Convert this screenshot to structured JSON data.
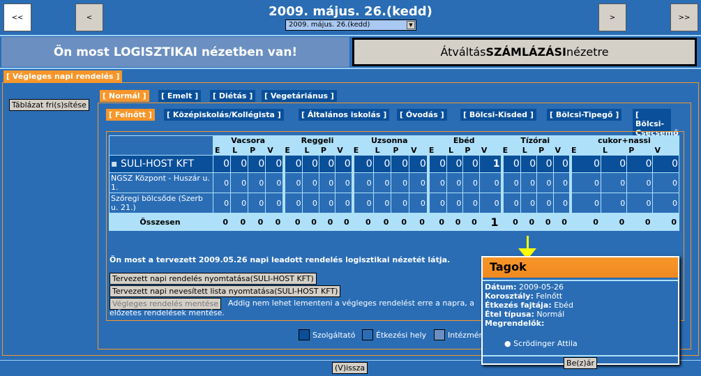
{
  "header": {
    "title": "2009. május. 26.(kedd)",
    "date_select": "2009. május. 26.(kedd)",
    "first": "<<",
    "prev": "<",
    "next": ">",
    "last": ">>"
  },
  "banner": {
    "current": "Ön most LOGISZTIKAI nézetben van!",
    "switch_pre": "Átváltás ",
    "switch_bold": "SZÁMLÁZÁSI",
    "switch_post": " nézetre"
  },
  "main_tab": "[ Végleges napi rendelés ]",
  "refresh": "Táblázat fri(s)sítése",
  "type_tabs": [
    "[ Normál ]",
    "[ Emelt ]",
    "[ Diétás ]",
    "[ Vegetáriánus ]"
  ],
  "age_tabs": [
    "[ Felnőtt ]",
    "[ Középiskolás/Kollégista ]",
    "[ Általános iskolás ]",
    "[ Óvodás ]",
    "[ Bölcsi-Kisded ]",
    "[ Bölcsi-Tipegő ]",
    "[ Bölcsi-Csecsemő ]"
  ],
  "table": {
    "meals": [
      "Vacsora",
      "Reggeli",
      "Uzsonna",
      "Ebéd",
      "Tízórai",
      "cukor+nassi"
    ],
    "sub": [
      "E",
      "L",
      "P",
      "V"
    ],
    "rows": [
      {
        "name": "SULI-HOST KFT",
        "values": [
          0,
          0,
          0,
          0,
          0,
          0,
          0,
          0,
          0,
          0,
          0,
          0,
          0,
          0,
          0,
          1,
          0,
          0,
          0,
          0,
          0,
          0,
          0,
          0
        ]
      },
      {
        "name": "NGSZ Központ - Huszár u. 1.",
        "values": [
          0,
          0,
          0,
          0,
          0,
          0,
          0,
          0,
          0,
          0,
          0,
          0,
          0,
          0,
          0,
          0,
          0,
          0,
          0,
          0,
          0,
          0,
          0,
          0
        ]
      },
      {
        "name": "Szőregi bölcsőde (Szerb u. 21.)",
        "values": [
          0,
          0,
          0,
          0,
          0,
          0,
          0,
          0,
          0,
          0,
          0,
          0,
          0,
          0,
          0,
          0,
          0,
          0,
          0,
          0,
          0,
          0,
          0,
          0
        ]
      }
    ],
    "total_label": "Összesen",
    "totals": [
      0,
      0,
      0,
      0,
      0,
      0,
      0,
      0,
      0,
      0,
      0,
      0,
      0,
      0,
      0,
      1,
      0,
      0,
      0,
      0,
      0,
      0,
      0,
      0
    ]
  },
  "info": "Ön most a tervezett 2009.05.26 napi leadott rendelés logisztikai nézetét látja.",
  "print1": "Tervezett napi rendelés nyomtatása(SULI-HOST KFT)",
  "print2": "Tervezett napi nevesített lista nyomtatása(SULI-HOST KFT)",
  "save": "Végleges rendelés mentése",
  "save_note": "Addig nem lehet lementeni a végleges rendelést erre a napra, a",
  "save_note2": "előzetes rendelések mentése.",
  "legend": [
    {
      "label": "Szolgáltató",
      "color": "#0a4f9a"
    },
    {
      "label": "Étkezési hely",
      "color": "#2a6db5"
    },
    {
      "label": "Intézmén",
      "color": "#6b8fc0"
    }
  ],
  "back": "(V)issza",
  "popup": {
    "title": "Tagok",
    "date_l": "Dátum:",
    "date": " 2009-05-26",
    "age_l": "Korosztály:",
    "age": " Felnőtt",
    "meal_l": "Étkezés fajtája:",
    "meal": " Ebéd",
    "type_l": "Étel típusa:",
    "type": " Normál",
    "orderers_l": "Megrendelők:",
    "orderers": [
      "Scrödinger Attila"
    ],
    "close": "Be(z)ár"
  }
}
